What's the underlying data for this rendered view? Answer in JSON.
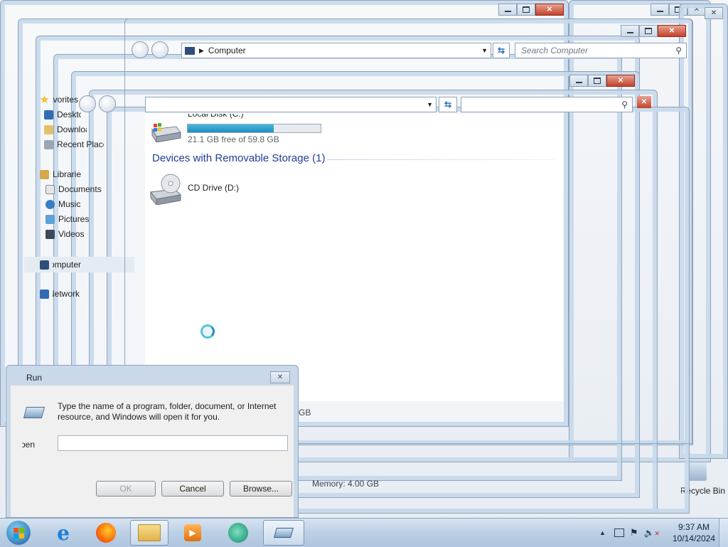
{
  "front_window": {
    "address": "Computer",
    "search_placeholder": "Search Computer"
  },
  "drives": {
    "local_disk": {
      "name": "Local Disk (C:)",
      "free_text": "21.1 GB free of 59.8 GB",
      "used_fraction": 0.647
    },
    "removable_group": "Devices with Removable Storage (1)",
    "cd_drive": {
      "name": "CD Drive (D:)"
    }
  },
  "sidebar": {
    "favorites_label": "Favorites",
    "items": [
      {
        "label": "Desktop",
        "icon": "desktop-icon"
      },
      {
        "label": "Downloads",
        "icon": "downloads-icon"
      },
      {
        "label": "Recent Places",
        "icon": "recent-places-icon"
      },
      {
        "label": "Libraries",
        "icon": "libraries-icon"
      },
      {
        "label": "Documents",
        "icon": "documents-icon"
      },
      {
        "label": "Music",
        "icon": "music-icon"
      },
      {
        "label": "Pictures",
        "icon": "pictures-icon"
      },
      {
        "label": "Videos",
        "icon": "videos-icon"
      },
      {
        "label": "Computer",
        "icon": "computer-icon"
      },
      {
        "label": "Network",
        "icon": "network-icon"
      }
    ]
  },
  "details": {
    "memory": "Memory: 4.00 GB",
    "size_fragment": "GB"
  },
  "run_dialog": {
    "title": "Run",
    "description": "Type the name of a program, folder, document, or Internet resource, and Windows will open it for you.",
    "open_label": "Open:",
    "ok": "OK",
    "cancel": "Cancel",
    "browse": "Browse..."
  },
  "desktop": {
    "recycle_bin": "Recycle Bin"
  },
  "taskbar": {
    "time": "9:37 AM",
    "date": "10/14/2024"
  }
}
